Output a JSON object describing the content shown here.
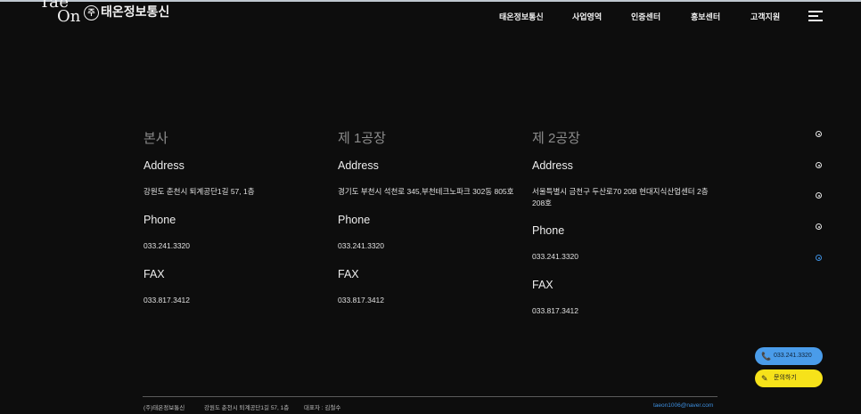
{
  "header": {
    "logo_line1": "Tae",
    "logo_line2": "On",
    "company_mark": "주",
    "company_name": "태온정보통신",
    "nav": [
      "태온정보통신",
      "사업영역",
      "인증센터",
      "홍보센터",
      "고객지원"
    ]
  },
  "locations": [
    {
      "title": "본사",
      "address_label": "Address",
      "address": "강원도 춘천시 퇴계공단1길 57, 1층",
      "phone_label": "Phone",
      "phone": "033.241.3320",
      "fax_label": "FAX",
      "fax": "033.817.3412"
    },
    {
      "title": "제 1공장",
      "address_label": "Address",
      "address": "경기도 부천시 석천로 345,부천테크노파크 302동 805호",
      "phone_label": "Phone",
      "phone": "033.241.3320",
      "fax_label": "FAX",
      "fax": "033.817.3412"
    },
    {
      "title": "제 2공장",
      "address_label": "Address",
      "address": "서울특별시 금천구 두산로70 20B 현대지식산업센터 2층 208호",
      "phone_label": "Phone",
      "phone": "033.241.3320",
      "fax_label": "FAX",
      "fax": "033.817.3412"
    }
  ],
  "side_nav": {
    "count": 5,
    "active_index": 4,
    "active_color": "#3d8fe0"
  },
  "float_buttons": {
    "phone": "033.241.3320",
    "inquiry": "문의하기"
  },
  "footer": {
    "company": "(주)태온정보통신",
    "address": "강원도 춘천시 퇴계공단1길 57, 1층",
    "ceo": "대표자 : 김철수",
    "email": "taeon1006@naver.com"
  },
  "icons": {
    "menu": "hamburger-menu-icon",
    "phone": "phone-icon",
    "inquiry": "pencil-icon"
  }
}
